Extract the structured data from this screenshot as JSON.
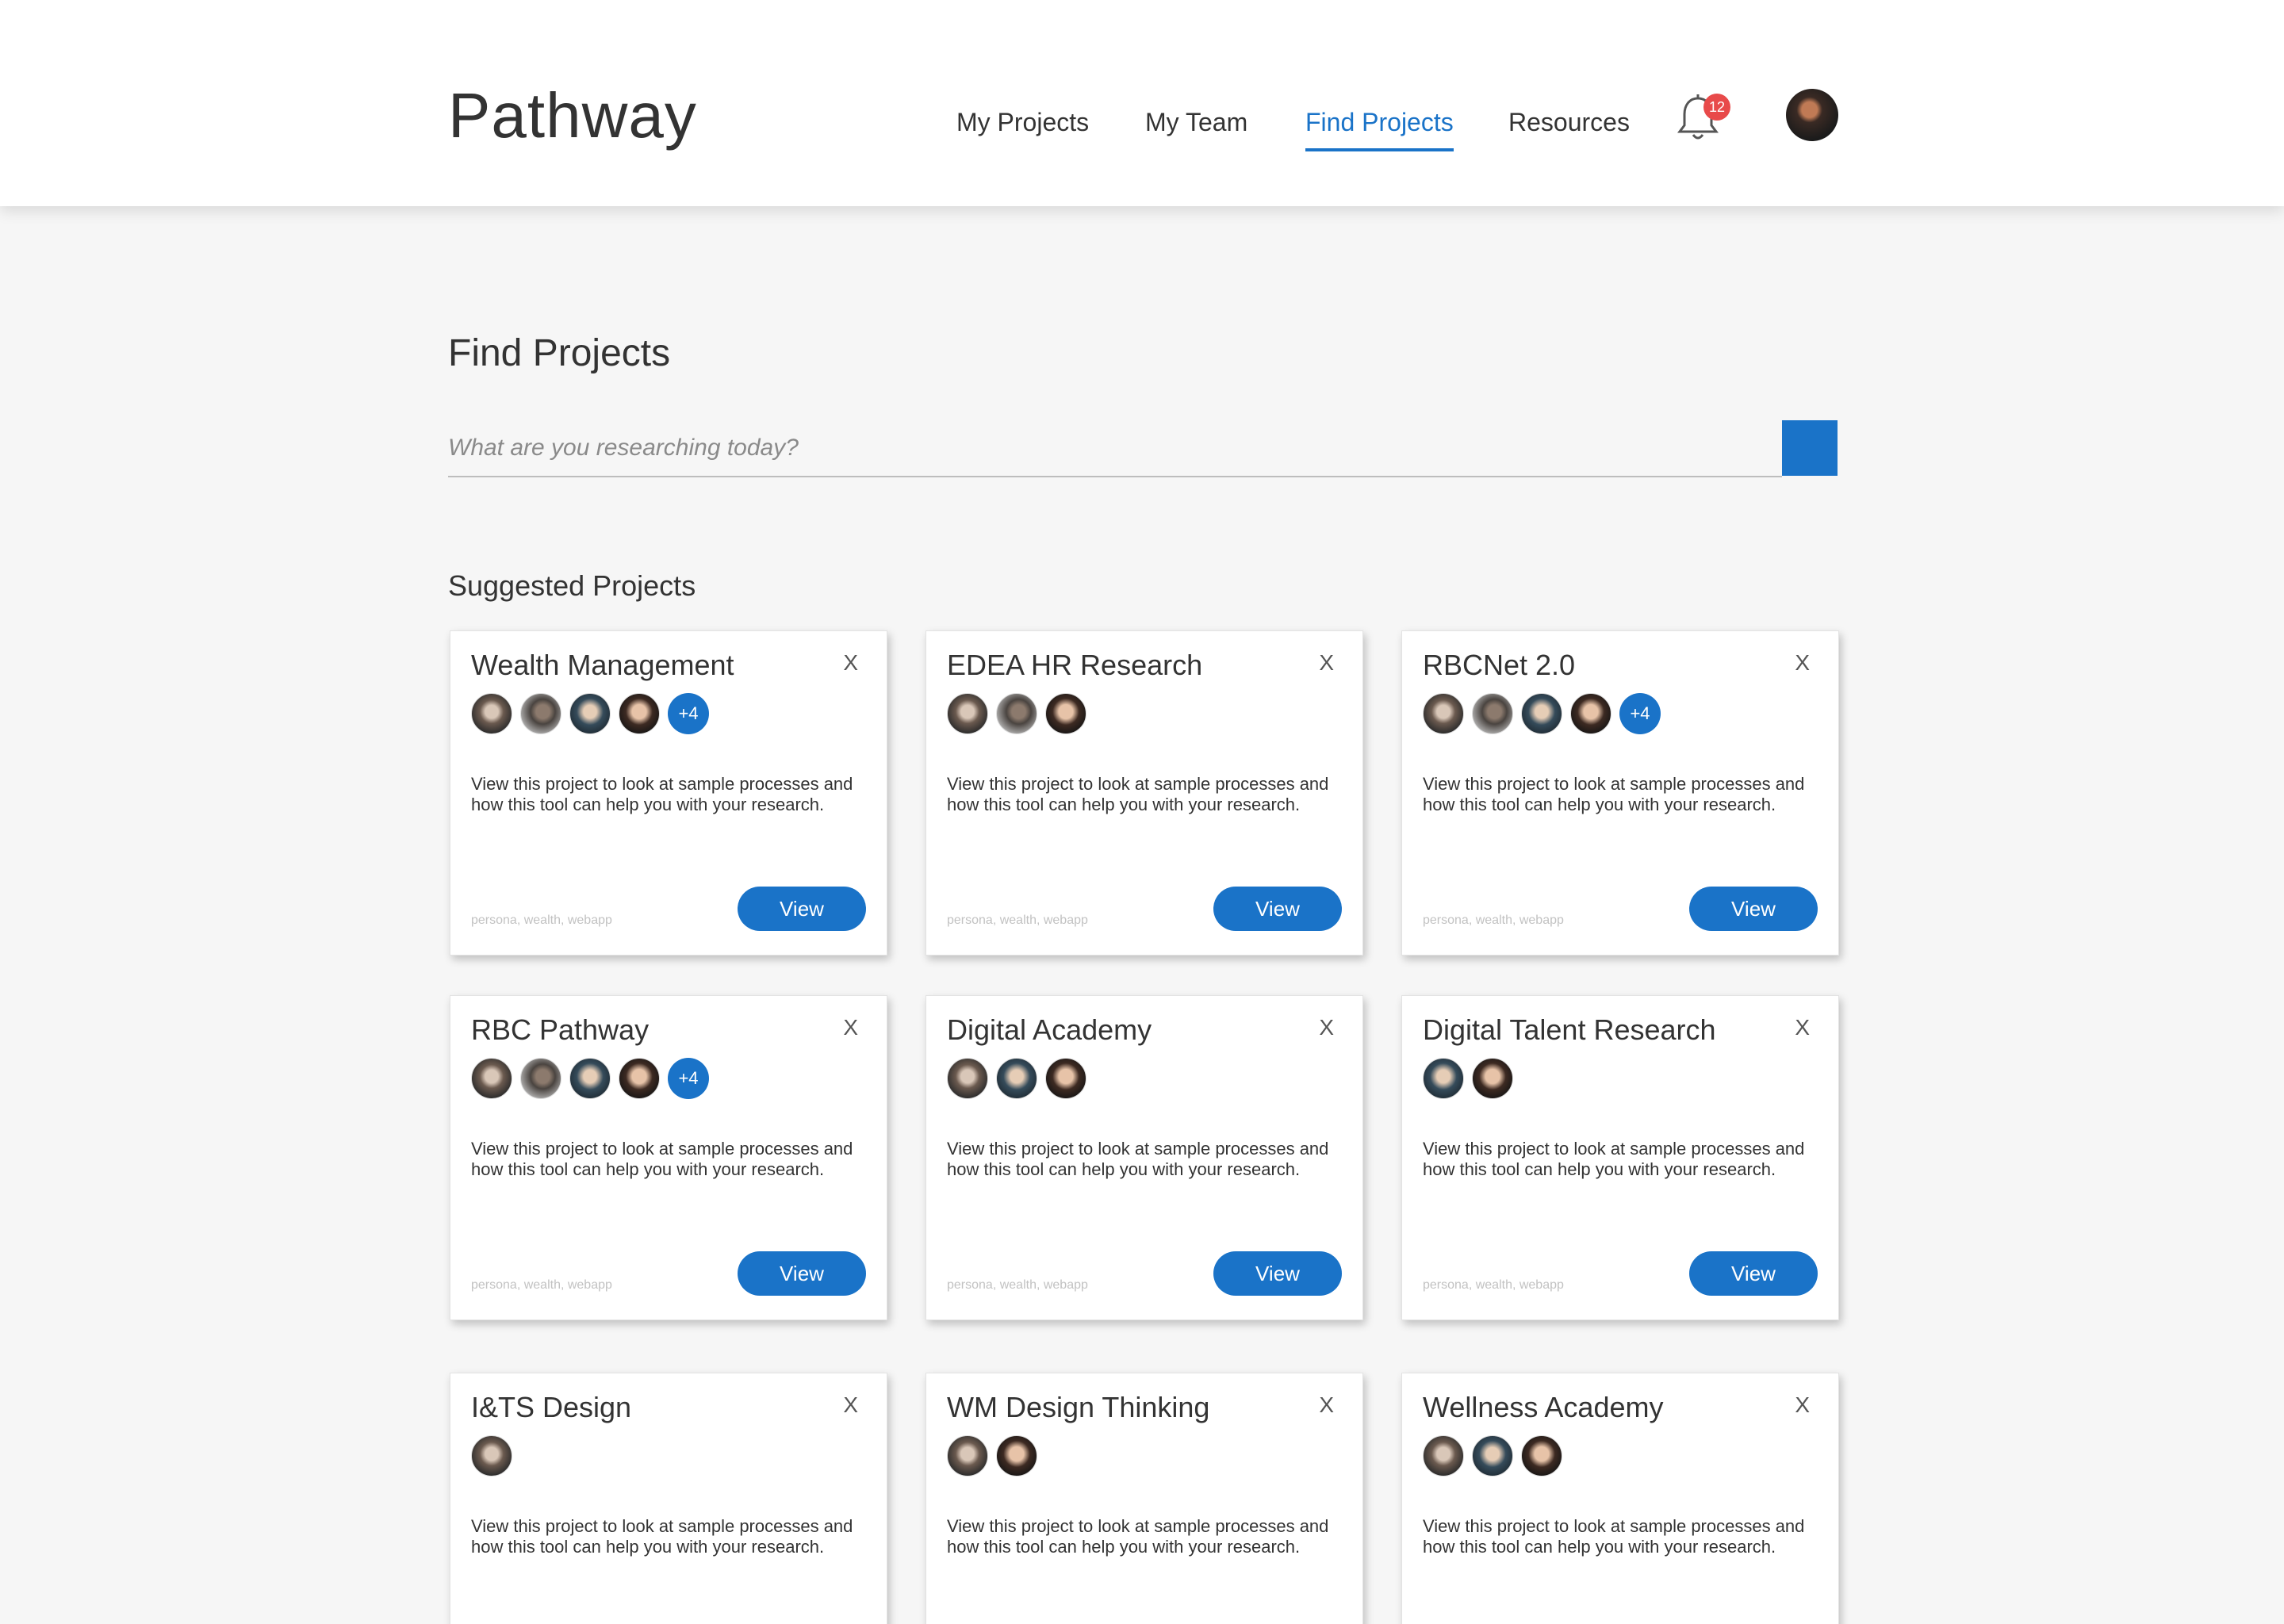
{
  "app": {
    "title": "Pathway"
  },
  "nav": {
    "items": [
      {
        "label": "My Projects"
      },
      {
        "label": "My Team"
      },
      {
        "label": "Find Projects",
        "active": true
      },
      {
        "label": "Resources"
      }
    ],
    "notifications_count": "12"
  },
  "colors": {
    "accent": "#1a73c8",
    "badge": "#e84a4a"
  },
  "page": {
    "title": "Find Projects",
    "search_placeholder": "What are you researching today?",
    "section_title": "Suggested Projects"
  },
  "cards": [
    {
      "title": "Wealth Management",
      "more": "+4",
      "desc": "View this project to look at sample processes and how this tool can help you with your research.",
      "tags": "persona, wealth, webapp",
      "button": "View"
    },
    {
      "title": "EDEA HR Research",
      "desc": "View this project to look at sample processes and how this tool can help you with your research.",
      "tags": "persona, wealth, webapp",
      "button": "View"
    },
    {
      "title": "RBCNet 2.0",
      "more": "+4",
      "desc": "View this project to look at sample processes and how this tool can help you with your research.",
      "tags": "persona, wealth, webapp",
      "button": "View"
    },
    {
      "title": "RBC Pathway",
      "more": "+4",
      "desc": "View this project to look at sample processes and how this tool can help you with your research.",
      "tags": "persona, wealth, webapp",
      "button": "View"
    },
    {
      "title": "Digital Academy",
      "desc": "View this project to look at sample processes and how this tool can help you with your research.",
      "tags": "persona, wealth, webapp",
      "button": "View"
    },
    {
      "title": "Digital Talent Research",
      "desc": "View this project to look at sample processes and how this tool can help you with your research.",
      "tags": "persona, wealth, webapp",
      "button": "View"
    },
    {
      "title": "I&TS Design",
      "desc": "View this project to look at sample processes and how this tool can help you with your research."
    },
    {
      "title": "WM Design Thinking",
      "desc": "View this project to look at sample processes and how this tool can help you with your research."
    },
    {
      "title": "Wellness Academy",
      "desc": "View this project to look at sample processes and how this tool can help you with your research."
    }
  ],
  "close_label": "X"
}
